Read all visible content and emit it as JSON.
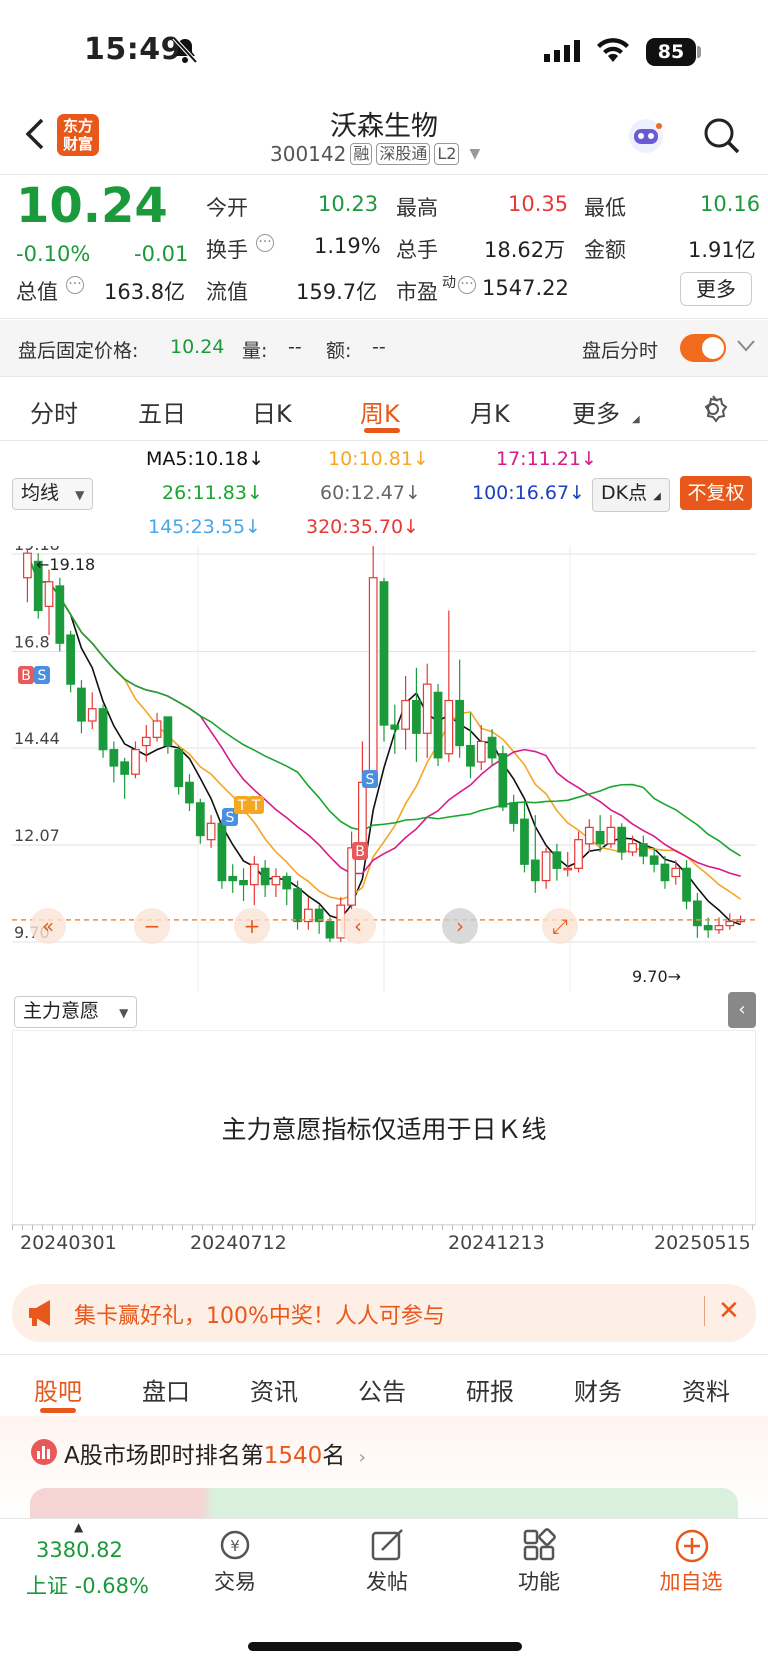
{
  "status_bar": {
    "time": "15:49",
    "battery": "85"
  },
  "header": {
    "logo_text": "东方财富",
    "stock_name": "沃森生物",
    "stock_code": "300142",
    "tags": [
      "融",
      "深股通",
      "L2"
    ]
  },
  "quote": {
    "price": "10.24",
    "change_pct": "-0.10%",
    "change": "-0.01",
    "open_label": "今开",
    "open": "10.23",
    "high_label": "最高",
    "high": "10.35",
    "low_label": "最低",
    "low": "10.16",
    "turnover_label": "换手",
    "turnover": "1.19%",
    "volume_label": "总手",
    "volume": "18.62万",
    "amount_label": "金额",
    "amount": "1.91亿",
    "mktcap_label": "总值",
    "mktcap": "163.8亿",
    "float_label": "流值",
    "float": "159.7亿",
    "pe_label": "市盈",
    "pe_sup": "动",
    "pe": "1547.22",
    "more": "更多"
  },
  "after_hours": {
    "price_label": "盘后固定价格:",
    "price": "10.24",
    "vol_label": "量:",
    "vol": "--",
    "amt_label": "额:",
    "amt": "--",
    "toggle_label": "盘后分时"
  },
  "k_tabs": [
    "分时",
    "五日",
    "日K",
    "周K",
    "月K",
    "更多"
  ],
  "k_active": "周K",
  "ma_legend": {
    "select": "均线",
    "ma5": "MA5:10.18↓",
    "ma10": "10:10.81↓",
    "ma17": "17:11.21↓",
    "ma26": "26:11.83↓",
    "ma60": "60:12.47↓",
    "ma100": "100:16.67↓",
    "ma145": "145:23.55↓",
    "ma320": "320:35.70↓",
    "dk": "DK点",
    "fq": "不复权",
    "colors": {
      "ma5": "#111111",
      "ma10": "#f5a623",
      "ma17": "#d81b8a",
      "ma26": "#1aa52e",
      "ma60": "#777777",
      "ma100": "#1f3fbf",
      "ma145": "#4aa6e8",
      "ma320": "#e53935"
    }
  },
  "chart_data": {
    "type": "candlestick",
    "y_ticks": [
      "19.18",
      "16.8",
      "14.44",
      "12.07",
      "9.70"
    ],
    "max_label": "19.18",
    "min_label": "9.70",
    "ylim": [
      9.7,
      19.18
    ],
    "x_ticks": [
      "20240301",
      "20240712",
      "20241213",
      "20250515"
    ],
    "last_price_line": "10.24",
    "signals": [
      "B",
      "S",
      "S",
      "T",
      "T",
      "B",
      "S"
    ],
    "candles": [
      [
        18.6,
        19.2,
        18.0,
        19.3
      ],
      [
        19.0,
        17.8,
        17.6,
        19.2
      ],
      [
        17.9,
        18.5,
        17.2,
        18.8
      ],
      [
        18.4,
        17.0,
        16.8,
        18.6
      ],
      [
        17.2,
        16.0,
        15.8,
        17.3
      ],
      [
        15.9,
        15.1,
        14.8,
        16.1
      ],
      [
        15.1,
        15.4,
        14.9,
        15.8
      ],
      [
        15.4,
        14.4,
        14.2,
        15.5
      ],
      [
        14.4,
        14.0,
        13.6,
        14.6
      ],
      [
        14.1,
        13.8,
        13.2,
        14.2
      ],
      [
        13.8,
        14.4,
        13.7,
        14.6
      ],
      [
        14.5,
        14.7,
        14.1,
        15.0
      ],
      [
        14.7,
        15.1,
        14.6,
        15.3
      ],
      [
        15.2,
        14.5,
        14.3,
        15.2
      ],
      [
        14.4,
        13.5,
        13.3,
        14.5
      ],
      [
        13.6,
        13.1,
        12.9,
        13.8
      ],
      [
        13.1,
        12.3,
        12.1,
        13.2
      ],
      [
        12.2,
        12.6,
        12.0,
        12.8
      ],
      [
        12.6,
        11.2,
        11.0,
        12.7
      ],
      [
        11.3,
        11.2,
        10.9,
        11.6
      ],
      [
        11.2,
        11.1,
        10.7,
        11.5
      ],
      [
        11.1,
        11.6,
        10.6,
        11.8
      ],
      [
        11.5,
        11.1,
        10.8,
        11.7
      ],
      [
        11.1,
        11.3,
        10.8,
        11.5
      ],
      [
        11.3,
        11.0,
        10.6,
        11.4
      ],
      [
        11.0,
        10.2,
        10.0,
        11.2
      ],
      [
        10.2,
        10.5,
        10.0,
        10.8
      ],
      [
        10.5,
        10.2,
        9.9,
        10.6
      ],
      [
        10.2,
        9.8,
        9.7,
        10.3
      ],
      [
        9.8,
        10.6,
        9.7,
        10.8
      ],
      [
        10.6,
        12.0,
        10.5,
        12.4
      ],
      [
        12.0,
        13.6,
        11.8,
        14.6
      ],
      [
        13.6,
        18.6,
        13.5,
        19.8
      ],
      [
        18.5,
        15.0,
        14.6,
        18.6
      ],
      [
        15.0,
        14.9,
        14.3,
        15.5
      ],
      [
        14.9,
        15.6,
        14.4,
        16.2
      ],
      [
        15.6,
        14.8,
        14.1,
        16.4
      ],
      [
        14.8,
        16.0,
        14.2,
        16.5
      ],
      [
        15.8,
        14.2,
        14.0,
        16.0
      ],
      [
        14.3,
        15.6,
        14.1,
        17.8
      ],
      [
        15.6,
        14.5,
        14.2,
        16.6
      ],
      [
        14.5,
        14.0,
        13.7,
        15.3
      ],
      [
        14.1,
        14.6,
        13.9,
        15.0
      ],
      [
        14.7,
        14.2,
        14.0,
        14.9
      ],
      [
        14.3,
        13.0,
        12.9,
        14.5
      ],
      [
        13.1,
        12.6,
        12.4,
        13.3
      ],
      [
        12.7,
        11.6,
        11.4,
        13.1
      ],
      [
        11.7,
        11.2,
        10.9,
        12.8
      ],
      [
        11.2,
        11.9,
        11.0,
        12.0
      ],
      [
        11.9,
        11.5,
        11.2,
        12.1
      ],
      [
        11.5,
        11.5,
        11.3,
        11.9
      ],
      [
        11.5,
        12.2,
        11.4,
        12.4
      ],
      [
        12.1,
        12.5,
        11.9,
        12.7
      ],
      [
        12.4,
        12.1,
        11.9,
        12.8
      ],
      [
        12.1,
        12.5,
        12.0,
        12.8
      ],
      [
        12.5,
        11.9,
        11.7,
        12.6
      ],
      [
        11.9,
        12.1,
        11.8,
        12.3
      ],
      [
        12.1,
        11.8,
        11.6,
        12.3
      ],
      [
        11.8,
        11.6,
        11.4,
        12.0
      ],
      [
        11.6,
        11.2,
        11.0,
        11.8
      ],
      [
        11.3,
        11.5,
        11.1,
        11.7
      ],
      [
        11.5,
        10.7,
        10.5,
        11.7
      ],
      [
        10.7,
        10.1,
        9.8,
        10.9
      ],
      [
        10.1,
        10.0,
        9.8,
        10.3
      ],
      [
        10.0,
        10.1,
        9.9,
        10.3
      ],
      [
        10.1,
        10.2,
        10.0,
        10.4
      ],
      [
        10.2,
        10.24,
        10.16,
        10.35
      ]
    ]
  },
  "indicator": {
    "select": "主力意愿",
    "message": "主力意愿指标仅适用于日Ｋ线"
  },
  "promo": {
    "text": "集卡赢好礼，100%中奖！人人可参与"
  },
  "bottom_tabs": [
    "股吧",
    "盘口",
    "资讯",
    "公告",
    "研报",
    "财务",
    "资料"
  ],
  "bottom_active": "股吧",
  "rank": {
    "prefix": "A股市场即时排名第",
    "num": "1540",
    "suffix": "名"
  },
  "bottom_nav": {
    "index_value": "3380.82",
    "index_label": "上证 -0.68%",
    "items": [
      "交易",
      "发帖",
      "功能",
      "加自选"
    ]
  }
}
